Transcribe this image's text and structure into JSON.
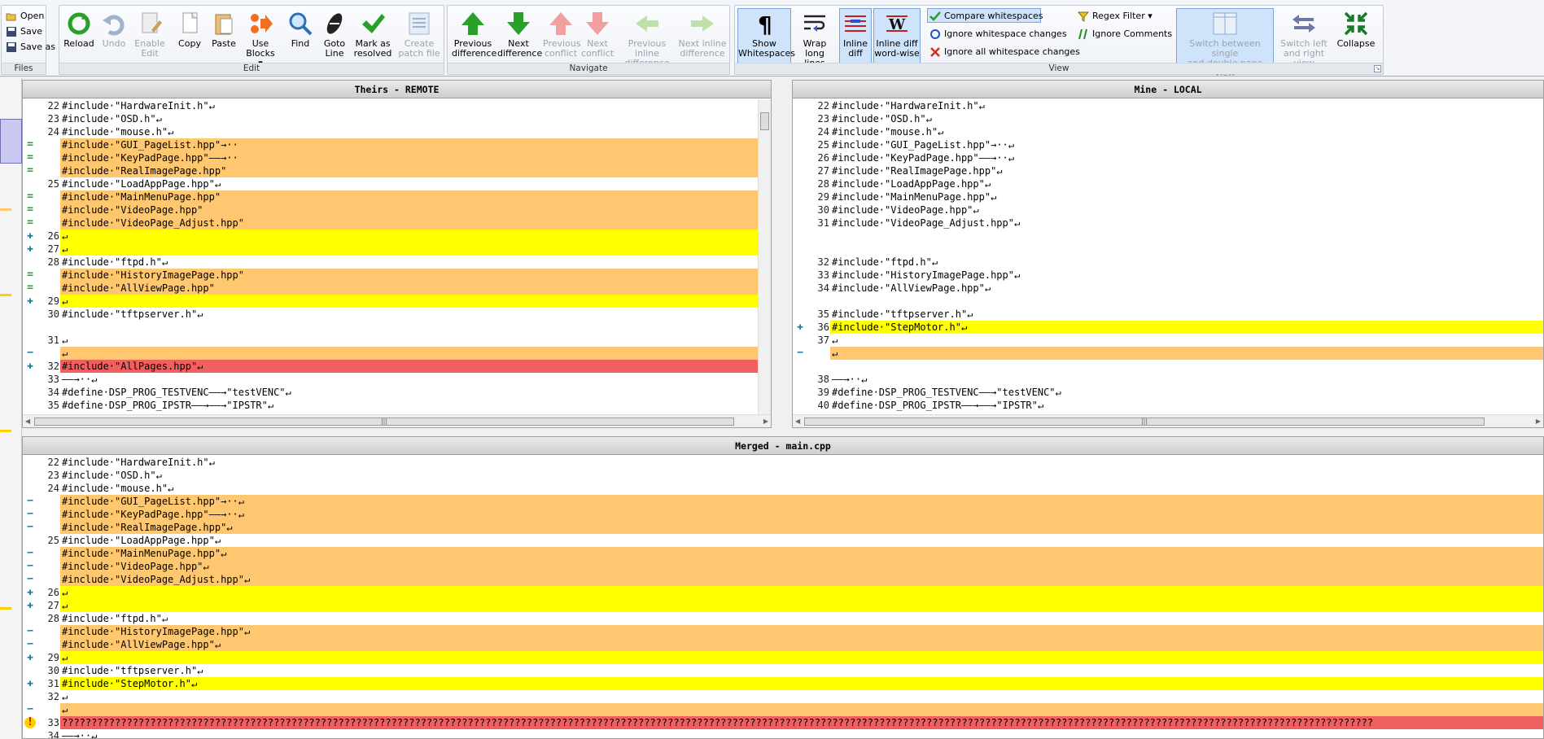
{
  "ribbon": {
    "files": {
      "label": "Files",
      "open": "Open",
      "save": "Save",
      "save_as": "Save as"
    },
    "edit": {
      "label": "Edit",
      "reload": "Reload",
      "undo": "Undo",
      "enable_edit_1": "Enable",
      "enable_edit_2": "Edit",
      "copy": "Copy",
      "paste": "Paste",
      "use_blocks_1": "Use",
      "use_blocks_2": "Blocks ▾",
      "find": "Find",
      "goto_1": "Goto",
      "goto_2": "Line",
      "mark_1": "Mark as",
      "mark_2": "resolved",
      "patch_1": "Create",
      "patch_2": "patch file"
    },
    "navigate": {
      "label": "Navigate",
      "prev_diff_1": "Previous",
      "prev_diff_2": "difference",
      "next_diff_1": "Next",
      "next_diff_2": "difference",
      "prev_conf_1": "Previous",
      "prev_conf_2": "conflict",
      "next_conf_1": "Next",
      "next_conf_2": "conflict",
      "prev_inline_1": "Previous inline",
      "prev_inline_2": "difference",
      "next_inline_1": "Next inline",
      "next_inline_2": "difference"
    },
    "view": {
      "label": "View",
      "show_ws_1": "Show",
      "show_ws_2": "Whitespaces",
      "wrap_1": "Wrap",
      "wrap_2": "long lines",
      "inline_1": "Inline",
      "inline_2": "diff",
      "inline_word_1": "Inline diff",
      "inline_word_2": "word-wise",
      "compare_ws": "Compare whitespaces",
      "ignore_ws_changes": "Ignore whitespace changes",
      "ignore_all_ws": "Ignore all whitespace changes",
      "regex_filter": "Regex Filter ▾",
      "ignore_comments": "Ignore Comments",
      "switch_single_1": "Switch between single",
      "switch_single_2": "and double pane view",
      "switch_lr_1": "Switch left",
      "switch_lr_2": "and right view",
      "collapse": "Collapse"
    }
  },
  "panes": {
    "theirs": {
      "title": "Theirs - REMOTE",
      "lines": [
        {
          "n": "22",
          "t": "#include·\"HardwareInit.h\"↵",
          "k": "blank",
          "m": ""
        },
        {
          "n": "23",
          "t": "#include·\"OSD.h\"↵",
          "k": "blank",
          "m": ""
        },
        {
          "n": "24",
          "t": "#include·\"mouse.h\"↵",
          "k": "blank",
          "m": ""
        },
        {
          "n": "",
          "t": "#include·\"GUI_PageList.hpp\"→··",
          "k": "changed",
          "m": "="
        },
        {
          "n": "",
          "t": "#include·\"KeyPadPage.hpp\"——→··",
          "k": "changed",
          "m": "="
        },
        {
          "n": "",
          "t": "#include·\"RealImagePage.hpp\"",
          "k": "changed",
          "m": "="
        },
        {
          "n": "25",
          "t": "#include·\"LoadAppPage.hpp\"↵",
          "k": "blank",
          "m": ""
        },
        {
          "n": "",
          "t": "#include·\"MainMenuPage.hpp\"",
          "k": "changed",
          "m": "="
        },
        {
          "n": "",
          "t": "#include·\"VideoPage.hpp\"",
          "k": "changed",
          "m": "="
        },
        {
          "n": "",
          "t": "#include·\"VideoPage_Adjust.hpp\"",
          "k": "changed",
          "m": "="
        },
        {
          "n": "26",
          "t": "↵",
          "k": "added",
          "m": "+"
        },
        {
          "n": "27",
          "t": "↵",
          "k": "added",
          "m": "+"
        },
        {
          "n": "28",
          "t": "#include·\"ftpd.h\"↵",
          "k": "blank",
          "m": ""
        },
        {
          "n": "",
          "t": "#include·\"HistoryImagePage.hpp\"",
          "k": "changed",
          "m": "="
        },
        {
          "n": "",
          "t": "#include·\"AllViewPage.hpp\"",
          "k": "changed",
          "m": "="
        },
        {
          "n": "29",
          "t": "↵",
          "k": "added",
          "m": "+"
        },
        {
          "n": "30",
          "t": "#include·\"tftpserver.h\"↵",
          "k": "blank",
          "m": ""
        },
        {
          "n": "",
          "t": "",
          "k": "gap",
          "m": ""
        },
        {
          "n": "31",
          "t": "↵",
          "k": "blank",
          "m": ""
        },
        {
          "n": "",
          "t": "↵",
          "k": "changed",
          "m": "−"
        },
        {
          "n": "32",
          "t": "#include·\"AllPages.hpp\"↵",
          "k": "conflict",
          "m": "+"
        },
        {
          "n": "33",
          "t": "——→··↵",
          "k": "blank",
          "m": ""
        },
        {
          "n": "34",
          "t": "#define·DSP_PROG_TESTVENC——→\"testVENC\"↵",
          "k": "blank",
          "m": ""
        },
        {
          "n": "35",
          "t": "#define·DSP_PROG_IPSTR——→——→\"IPSTR\"↵",
          "k": "blank",
          "m": ""
        }
      ]
    },
    "mine": {
      "title": "Mine - LOCAL",
      "lines": [
        {
          "n": "22",
          "t": "#include·\"HardwareInit.h\"↵",
          "k": "blank",
          "m": ""
        },
        {
          "n": "23",
          "t": "#include·\"OSD.h\"↵",
          "k": "blank",
          "m": ""
        },
        {
          "n": "24",
          "t": "#include·\"mouse.h\"↵",
          "k": "blank",
          "m": ""
        },
        {
          "n": "25",
          "t": "#include·\"GUI_PageList.hpp\"→··↵",
          "k": "blank",
          "m": ""
        },
        {
          "n": "26",
          "t": "#include·\"KeyPadPage.hpp\"——→··↵",
          "k": "blank",
          "m": ""
        },
        {
          "n": "27",
          "t": "#include·\"RealImagePage.hpp\"↵",
          "k": "blank",
          "m": ""
        },
        {
          "n": "28",
          "t": "#include·\"LoadAppPage.hpp\"↵",
          "k": "blank",
          "m": ""
        },
        {
          "n": "29",
          "t": "#include·\"MainMenuPage.hpp\"↵",
          "k": "blank",
          "m": ""
        },
        {
          "n": "30",
          "t": "#include·\"VideoPage.hpp\"↵",
          "k": "blank",
          "m": ""
        },
        {
          "n": "31",
          "t": "#include·\"VideoPage_Adjust.hpp\"↵",
          "k": "blank",
          "m": ""
        },
        {
          "n": "",
          "t": "",
          "k": "gap",
          "m": ""
        },
        {
          "n": "",
          "t": "",
          "k": "gap",
          "m": ""
        },
        {
          "n": "32",
          "t": "#include·\"ftpd.h\"↵",
          "k": "blank",
          "m": ""
        },
        {
          "n": "33",
          "t": "#include·\"HistoryImagePage.hpp\"↵",
          "k": "blank",
          "m": ""
        },
        {
          "n": "34",
          "t": "#include·\"AllViewPage.hpp\"↵",
          "k": "blank",
          "m": ""
        },
        {
          "n": "",
          "t": "",
          "k": "gap",
          "m": ""
        },
        {
          "n": "35",
          "t": "#include·\"tftpserver.h\"↵",
          "k": "blank",
          "m": ""
        },
        {
          "n": "36",
          "t": "#include·\"StepMotor.h\"↵",
          "k": "added",
          "m": "+"
        },
        {
          "n": "37",
          "t": "↵",
          "k": "blank",
          "m": ""
        },
        {
          "n": "",
          "t": "↵",
          "k": "changed",
          "m": "−"
        },
        {
          "n": "",
          "t": "",
          "k": "conflict",
          "m": ""
        },
        {
          "n": "38",
          "t": "——→··↵",
          "k": "blank",
          "m": ""
        },
        {
          "n": "39",
          "t": "#define·DSP_PROG_TESTVENC——→\"testVENC\"↵",
          "k": "blank",
          "m": ""
        },
        {
          "n": "40",
          "t": "#define·DSP_PROG_IPSTR——→——→\"IPSTR\"↵",
          "k": "blank",
          "m": ""
        }
      ]
    },
    "merged": {
      "title": "Merged - main.cpp",
      "lines": [
        {
          "n": "22",
          "t": "#include·\"HardwareInit.h\"↵",
          "k": "blank",
          "m": ""
        },
        {
          "n": "23",
          "t": "#include·\"OSD.h\"↵",
          "k": "blank",
          "m": ""
        },
        {
          "n": "24",
          "t": "#include·\"mouse.h\"↵",
          "k": "blank",
          "m": ""
        },
        {
          "n": "",
          "t": "#include·\"GUI_PageList.hpp\"→··↵",
          "k": "changed",
          "m": "−"
        },
        {
          "n": "",
          "t": "#include·\"KeyPadPage.hpp\"——→··↵",
          "k": "changed",
          "m": "−"
        },
        {
          "n": "",
          "t": "#include·\"RealImagePage.hpp\"↵",
          "k": "changed",
          "m": "−"
        },
        {
          "n": "25",
          "t": "#include·\"LoadAppPage.hpp\"↵",
          "k": "blank",
          "m": ""
        },
        {
          "n": "",
          "t": "#include·\"MainMenuPage.hpp\"↵",
          "k": "changed",
          "m": "−"
        },
        {
          "n": "",
          "t": "#include·\"VideoPage.hpp\"↵",
          "k": "changed",
          "m": "−"
        },
        {
          "n": "",
          "t": "#include·\"VideoPage_Adjust.hpp\"↵",
          "k": "changed",
          "m": "−"
        },
        {
          "n": "26",
          "t": "↵",
          "k": "added",
          "m": "+"
        },
        {
          "n": "27",
          "t": "↵",
          "k": "added",
          "m": "+"
        },
        {
          "n": "28",
          "t": "#include·\"ftpd.h\"↵",
          "k": "blank",
          "m": ""
        },
        {
          "n": "",
          "t": "#include·\"HistoryImagePage.hpp\"↵",
          "k": "changed",
          "m": "−"
        },
        {
          "n": "",
          "t": "#include·\"AllViewPage.hpp\"↵",
          "k": "changed",
          "m": "−"
        },
        {
          "n": "29",
          "t": "↵",
          "k": "added",
          "m": "+"
        },
        {
          "n": "30",
          "t": "#include·\"tftpserver.h\"↵",
          "k": "blank",
          "m": ""
        },
        {
          "n": "31",
          "t": "#include·\"StepMotor.h\"↵",
          "k": "added",
          "m": "+"
        },
        {
          "n": "32",
          "t": "↵",
          "k": "blank",
          "m": ""
        },
        {
          "n": "",
          "t": "↵",
          "k": "changed",
          "m": "−"
        },
        {
          "n": "33",
          "t": "???????????????????????????????????????????????????????????????????????????????????????????????????????????????????????????????????????????????????????????????????????????????????????????????????????????????????????????????",
          "k": "conflict",
          "m": "!"
        },
        {
          "n": "34",
          "t": "——→··↵",
          "k": "blank",
          "m": ""
        }
      ]
    }
  },
  "colors": {
    "changed": "#ffc870",
    "added": "#ffff00",
    "conflict": "#f06060",
    "gap": "#c8c8c8"
  }
}
